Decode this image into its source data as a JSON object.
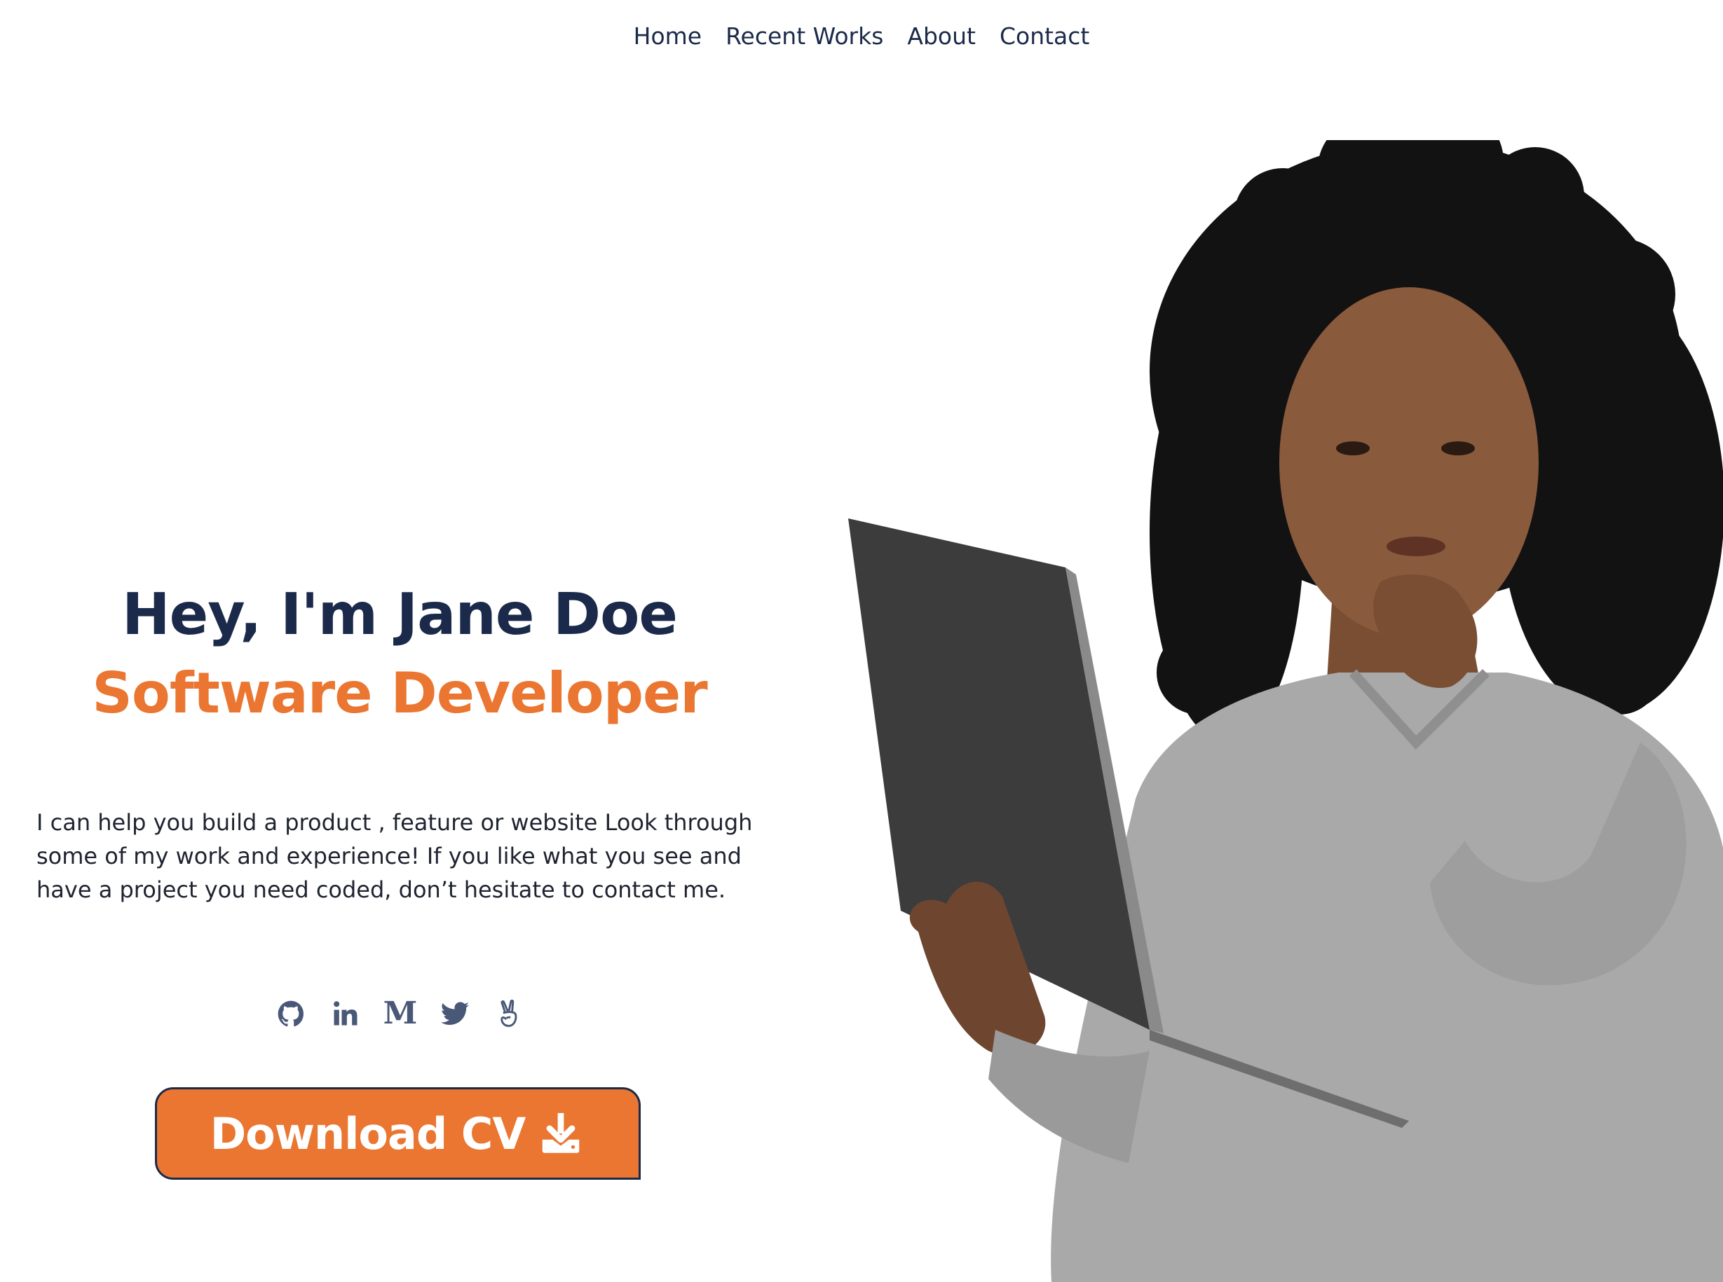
{
  "nav": {
    "items": [
      {
        "label": "Home"
      },
      {
        "label": "Recent Works"
      },
      {
        "label": "About"
      },
      {
        "label": "Contact"
      }
    ]
  },
  "hero": {
    "greeting": "Hey, I'm Jane Doe",
    "role": "Software Developer",
    "intro": "I can help you build a product , feature or website Look through some of my work and experience! If you like what you see and have a project you need coded, don’t hesitate to contact me.",
    "socials": [
      {
        "icon": "github-icon"
      },
      {
        "icon": "linkedin-icon",
        "glyph": "in"
      },
      {
        "icon": "medium-icon",
        "glyph": "M"
      },
      {
        "icon": "twitter-icon"
      },
      {
        "icon": "angellist-icon"
      }
    ],
    "cv_button_label": "Download CV",
    "cv_button_icon": "download-icon"
  },
  "colors": {
    "navy": "#1b2a4a",
    "accent": "#ea7631",
    "icon": "#4a5878",
    "sweater": "#a9a9a9",
    "laptop": "#3c3c3c",
    "skin": "#8a5a3c",
    "hair": "#121212"
  }
}
